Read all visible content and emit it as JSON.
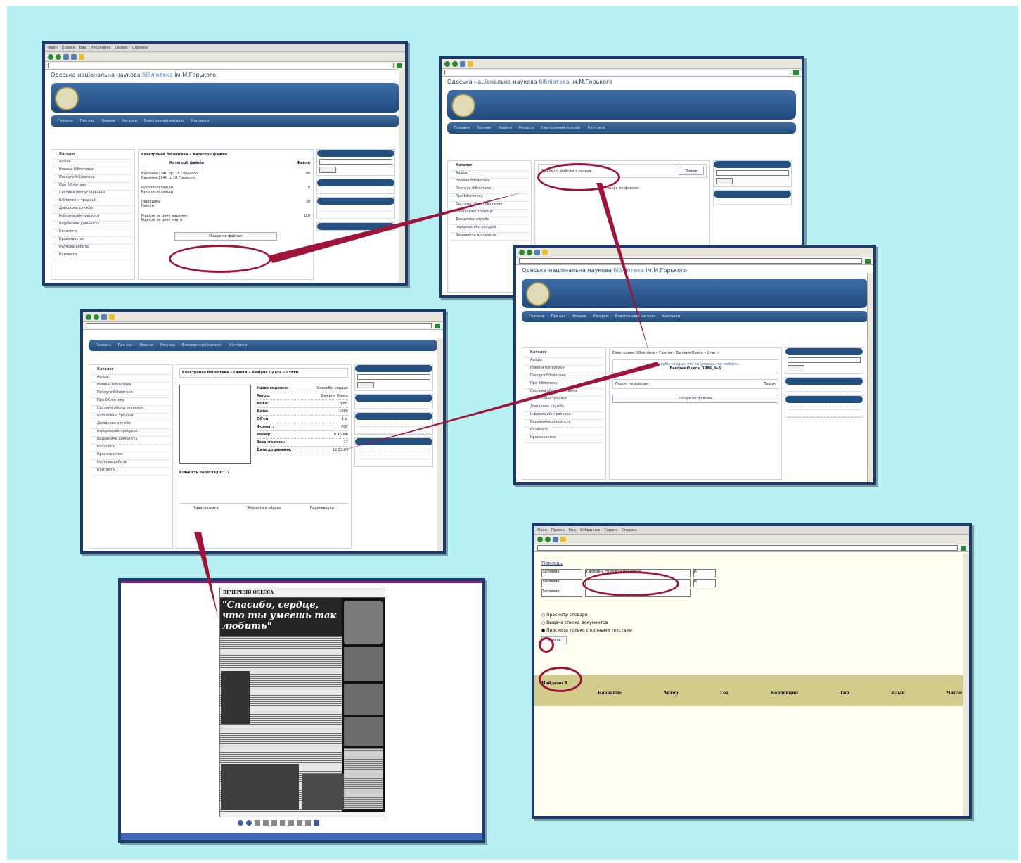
{
  "shot1": {
    "menu": [
      "Файл",
      "Правка",
      "Вид",
      "Избранное",
      "Сервис",
      "Справка"
    ],
    "lib_title_prefix": "Одеська національна наукова",
    "lib_title_highlight": "бібліотека",
    "lib_title_suffix": "ім.М.Горького",
    "nav": [
      "Головна",
      "Про нас",
      "Новини",
      "Ресурси",
      "Електронний каталог",
      "Контакти"
    ],
    "sidebar": [
      "Каталог",
      "Афіша",
      "Новини бібліотеки",
      "Послуги бібліотеки",
      "Про бібліотеку",
      "Система обслуговування",
      "Бібліотечні традиції",
      "Довідкова служба",
      "Інформаційні ресурси",
      "Видавнича діяльність",
      "Каталоги",
      "Краєзнавство",
      "Наукова робота",
      "Контакти"
    ],
    "content_crumb": "Електронна бібліотека  »  Категорії файлів",
    "table_header": "Категорії файлів",
    "table_header_right": "Файли",
    "rows": [
      {
        "title": "Видання 1940 рр. 18 Горького",
        "sub": "Видання 1940 р. 18 Горького",
        "count": "80"
      },
      {
        "title": "Рукописні фонди",
        "sub": "Рукописні фонди",
        "count": "8"
      },
      {
        "title": "Періодика",
        "sub": "Газети",
        "count": "30"
      },
      {
        "title": "Рідкісні та цінні видання",
        "sub": "Рідкісні та цінні книги",
        "count": "120"
      }
    ],
    "search_button": "Пошук по файлам"
  },
  "shot2": {
    "search_label": "Пошук по файлам з назвою",
    "search_button": "Пошук",
    "result_label": "Пошук по файлам"
  },
  "shot3": {
    "crumb": "Електронна бібліотека  »  Газети  »  Вечірня Одеса  »  Статті",
    "item_link": "«Спасибо, сердце, что ты умеешь так любить»",
    "item_meta": "Вечірня Одеса, 1986, №5",
    "search_label": "Пошук по файлам",
    "search_button": "Пошук",
    "result_label": "Пошук по файлам"
  },
  "shot4": {
    "header": "Електронна бібліотека  »  Газети  »  Вечірня Одеса  »  Статті",
    "fields": [
      {
        "k": "Назва видання:",
        "v": "Спасибо, сердце"
      },
      {
        "k": "Автор:",
        "v": "Вечірня Одеса"
      },
      {
        "k": "Мова:",
        "v": "рос."
      },
      {
        "k": "Дата:",
        "v": "1986"
      },
      {
        "k": "Об'єм:",
        "v": "1 с."
      },
      {
        "k": "Формат:",
        "v": "PDF"
      },
      {
        "k": "Розмір:",
        "v": "0.45 Мб"
      },
      {
        "k": "Завантажень:",
        "v": "17"
      },
      {
        "k": "Дата додавання:",
        "v": "12.03.09"
      }
    ],
    "count_label": "Кількість переглядів: 17",
    "bottom_links": [
      "Завантажити",
      "Зберегти в обране",
      "Переглянути"
    ]
  },
  "newspaper": {
    "masthead": "ВЕЧЕРНЯЯ ОДЕССА",
    "headline": "\"Спасибо, сердце, что ты умеешь так любить\""
  },
  "shot5": {
    "menu": [
      "Файл",
      "Правка",
      "Вид",
      "Избранное",
      "Сервис",
      "Справка"
    ],
    "link": "Помощь",
    "selects": [
      {
        "label": "Заглавие",
        "value": "У.Фомина Надежда Ивановна",
        "op": "И"
      },
      {
        "label": "Заглавие",
        "value": "",
        "op": "И"
      },
      {
        "label": "Заглавие",
        "value": "",
        "op": ""
      }
    ],
    "options": [
      "Просмотр словаря",
      "Выдача списка документов",
      "Просмотр только с полными текстами"
    ],
    "submit": "Искать",
    "found_label": "Найдено 3",
    "cols": [
      "Название",
      "Автор",
      "Год",
      "Коллекция",
      "Тип",
      "Язык",
      "Число"
    ]
  },
  "colors": {
    "background": "#b6f0f3",
    "frame": "#1e3a6b",
    "banner": "#1f4a7d",
    "arrow": "#a0143b",
    "result_bar": "#d2cb8c",
    "result_bg": "#fffff0"
  }
}
